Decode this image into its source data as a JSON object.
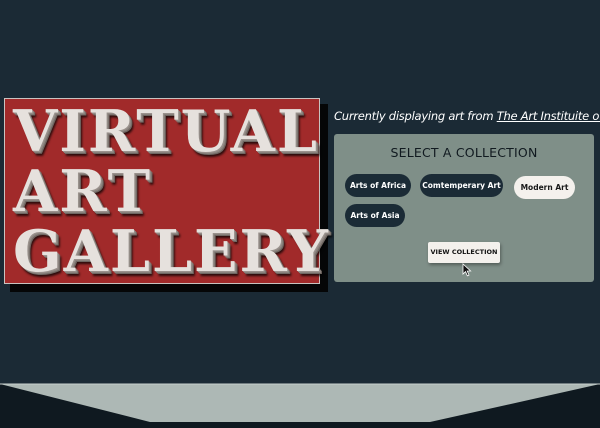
{
  "sign": {
    "line1": "VIRTUAL",
    "line2": "ART",
    "line3": "GALLERY"
  },
  "credit": {
    "prefix": "Currently displaying art from ",
    "link_text": "The Art Instituite of Chicago"
  },
  "panel": {
    "title": "SELECT A COLLECTION",
    "collections": [
      {
        "label": "Arts of Africa",
        "selected": false
      },
      {
        "label": "Comtemperary Art",
        "selected": false
      },
      {
        "label": "Modern Art",
        "selected": true
      },
      {
        "label": "Arts of Asia",
        "selected": false
      }
    ],
    "view_button": "VIEW COLLECTION"
  },
  "colors": {
    "background": "#1b2a35",
    "sign": "#a12a2a",
    "panel": "#7f8f88",
    "chip": "#1b2b36",
    "chip_selected": "#f4f1ed",
    "floor": "#adb8b5"
  },
  "icons": {
    "pointer": "mouse-pointer-icon"
  }
}
